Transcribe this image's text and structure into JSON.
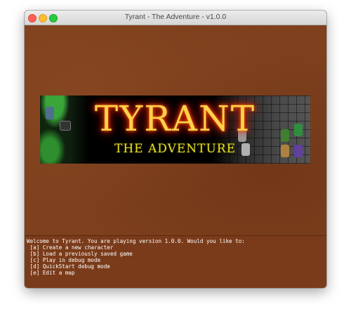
{
  "window": {
    "title": "Tyrant - The Adventure - v1.0.0"
  },
  "banner": {
    "title": "TYRANT",
    "subtitle": "THE ADVENTURE"
  },
  "console": {
    "prompt": "Welcome to Tyrant. You are playing version 1.0.0. Would you like to:",
    "options": [
      " [a] Create a new character",
      " [b] Load a previously saved game",
      " [c] Play in debug mode",
      " [d] QuickStart debug mode",
      " [e] Edit a map"
    ]
  },
  "colors": {
    "background": "#7e401d",
    "logo": "#ffd24a",
    "subtitle": "#e8e020",
    "console_text": "#ffffff"
  }
}
